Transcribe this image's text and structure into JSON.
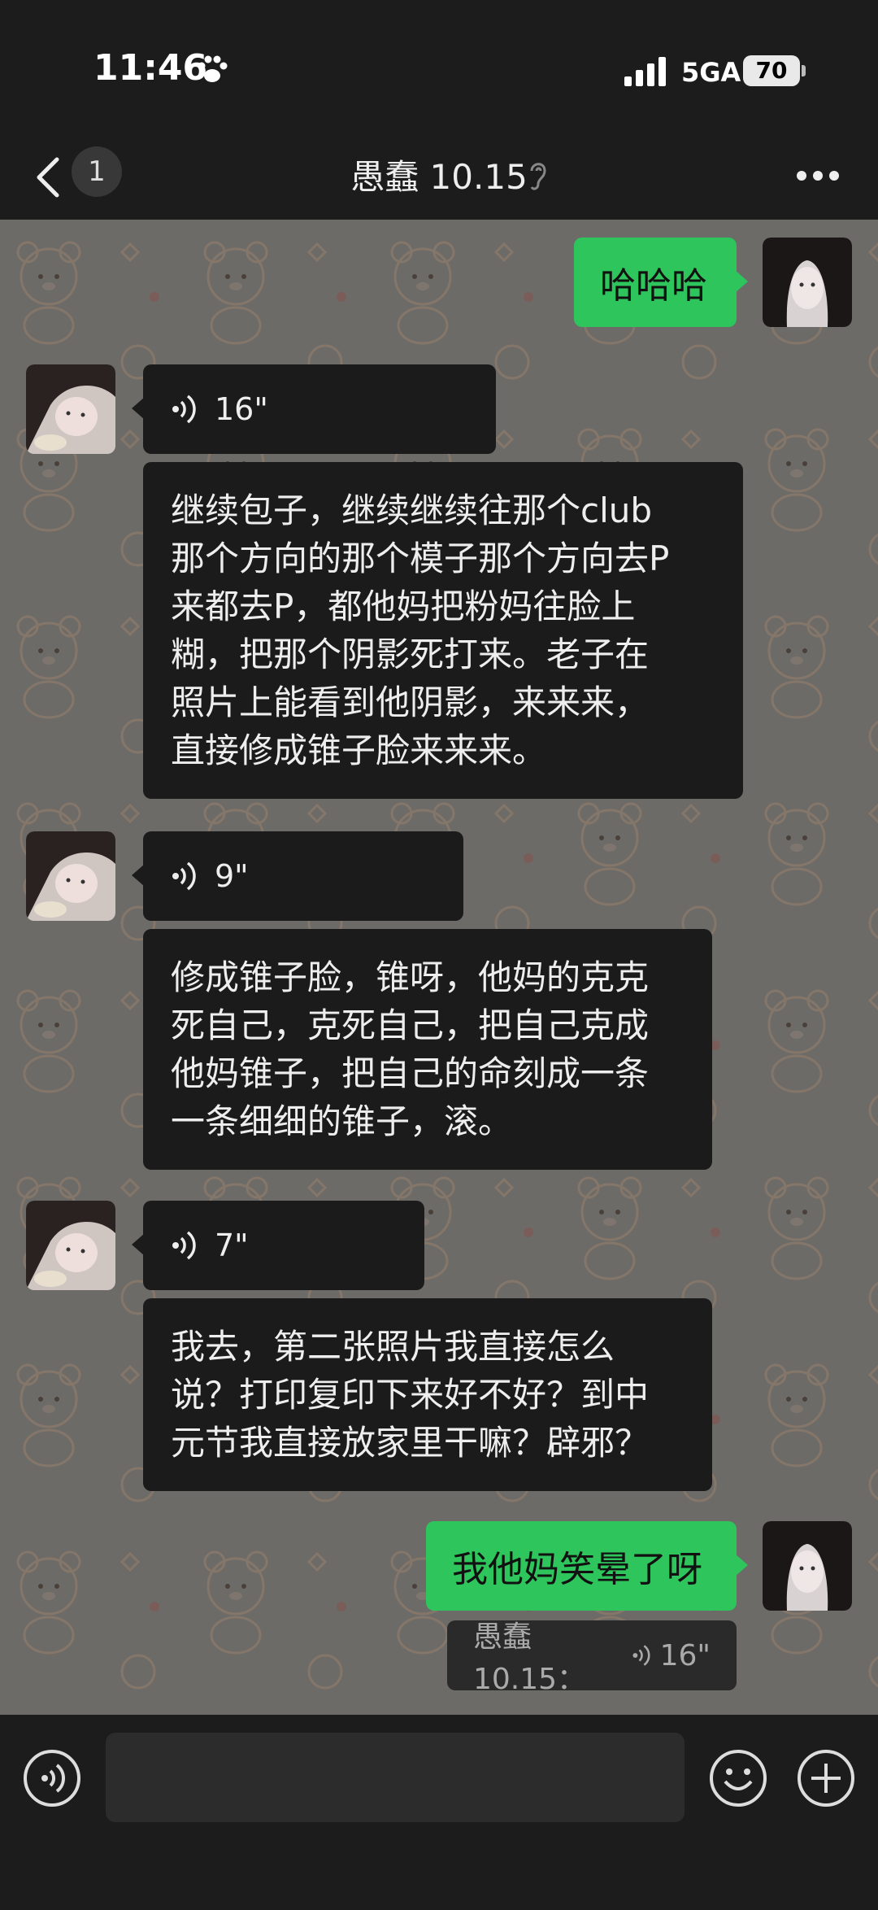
{
  "status_bar": {
    "time": "11:46",
    "network": "5GA",
    "battery": "70"
  },
  "header": {
    "unread_count": "1",
    "title": "愚蠢 10.15"
  },
  "messages": [
    {
      "side": "right",
      "type": "text",
      "text": "哈哈哈"
    },
    {
      "side": "left",
      "type": "voice",
      "duration": "16\""
    },
    {
      "side": "left",
      "type": "text",
      "text": "继续包子，继续继续往那个club\n那个方向的那个模子那个方向去P\n来都去P，都他妈把粉妈往脸上\n糊，把那个阴影死打来。老子在\n照片上能看到他阴影，来来来，\n直接修成锥子脸来来来。"
    },
    {
      "side": "left",
      "type": "voice",
      "duration": "9\""
    },
    {
      "side": "left",
      "type": "text",
      "text": "修成锥子脸，锥呀，他妈的克克\n死自己，克死自己，把自己克成\n他妈锥子，把自己的命刻成一条\n一条细细的锥子，滚。"
    },
    {
      "side": "left",
      "type": "voice",
      "duration": "7\""
    },
    {
      "side": "left",
      "type": "text",
      "text": "我去，第二张照片我直接怎么\n说？打印复印下来好不好？到中\n元节我直接放家里干嘛？辟邪？"
    },
    {
      "side": "right",
      "type": "text",
      "text": "我他妈笑晕了呀"
    }
  ],
  "quote": {
    "name": "愚蠢 10.15：",
    "duration": "16\""
  },
  "colors": {
    "green_bubble": "#2ec55c",
    "dark_bubble": "#1b1b1b",
    "bar_bg": "#1c1c1c"
  }
}
